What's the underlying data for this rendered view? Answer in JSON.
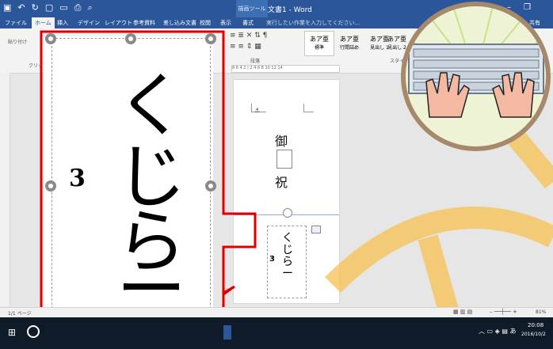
{
  "window": {
    "title": "文書1 - Word",
    "context_tab_header": "描画ツール",
    "tell_me": "実行したい作業を入力してください...",
    "share": "共有"
  },
  "tabs": [
    {
      "label": "ファイル"
    },
    {
      "label": "ホーム"
    },
    {
      "label": "挿入"
    },
    {
      "label": "デザイン"
    },
    {
      "label": "レイアウト"
    },
    {
      "label": "参考資料"
    },
    {
      "label": "差し込み文書"
    },
    {
      "label": "校閲"
    },
    {
      "label": "表示"
    },
    {
      "label": "書式"
    }
  ],
  "ribbon": {
    "paste_label": "貼り付け",
    "clipboard_label": "クリップ",
    "paragraph_label": "段落",
    "styles_label": "スタイル",
    "styles": [
      {
        "preview": "あア亜",
        "name": "標準"
      },
      {
        "preview": "あア亜",
        "name": "行間詰め"
      },
      {
        "preview": "あア亜",
        "name": "見出し 1"
      },
      {
        "preview": "あア亜",
        "name": "見出し 2"
      }
    ]
  },
  "ruler": {
    "marks": "8 6 4 2 | 2 4 6 8 10 12 14"
  },
  "page": {
    "text_top": "御",
    "text_bottom": "祝",
    "vertical_text": [
      "く",
      "じ",
      "ら",
      "ー"
    ],
    "side_mark": "3"
  },
  "zoom": {
    "vertical_text": [
      "く",
      "じ",
      "ら",
      "ー"
    ],
    "side_mark": "3"
  },
  "status": {
    "page_info": "1/1 ページ",
    "zoom_level": "81%"
  },
  "taskbar": {
    "time": "20:08",
    "date": "2016/10/2"
  },
  "colors": {
    "word_blue": "#2b579a",
    "callout_red": "#e00000",
    "arrow_yellow": "#f6c45a"
  }
}
